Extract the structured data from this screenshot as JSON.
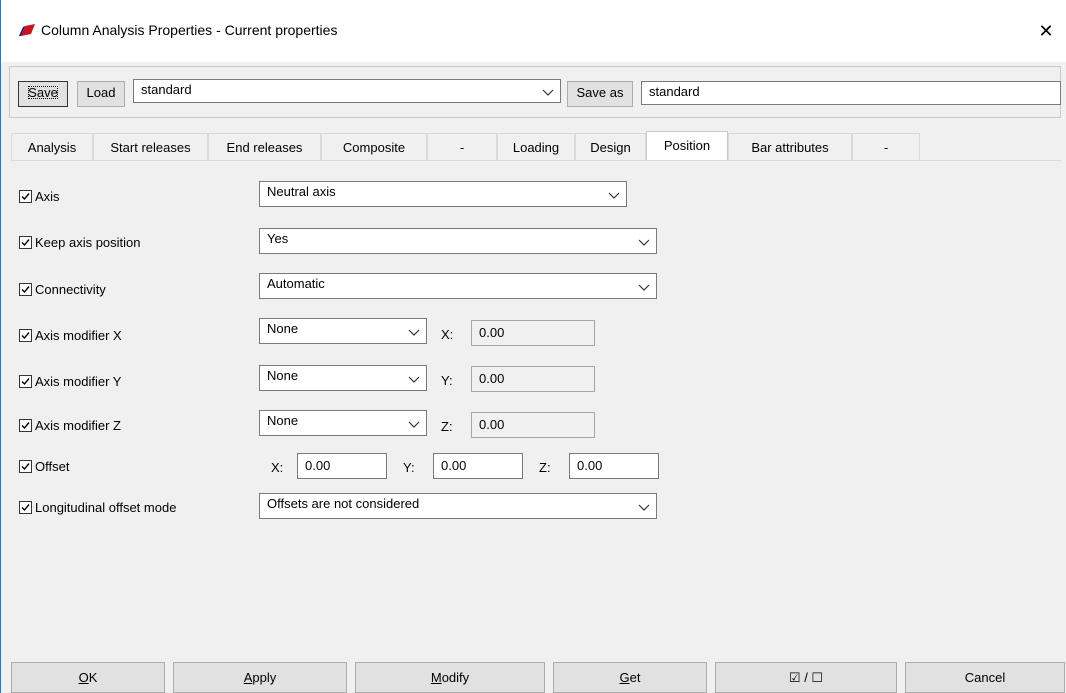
{
  "window": {
    "title": "Column Analysis Properties - Current properties",
    "close_glyph": "✕",
    "accent_color": "#1f77d0",
    "icon": "app-logo-icon"
  },
  "toolbar": {
    "save_label": "Save",
    "load_label": "Load",
    "preset_value": "standard",
    "save_as_label": "Save as",
    "save_as_value": "standard"
  },
  "tabs": [
    {
      "label": "Analysis"
    },
    {
      "label": "Start releases"
    },
    {
      "label": "End releases"
    },
    {
      "label": "Composite"
    },
    {
      "label": "-"
    },
    {
      "label": "Loading"
    },
    {
      "label": "Design"
    },
    {
      "label": "Position"
    },
    {
      "label": "Bar attributes"
    },
    {
      "label": "-"
    }
  ],
  "active_tab": "Position",
  "rows": {
    "axis": {
      "label": "Axis",
      "checked": true,
      "value": "Neutral axis"
    },
    "keep_axis": {
      "label": "Keep axis position",
      "checked": true,
      "value": "Yes"
    },
    "connectivity": {
      "label": "Connectivity",
      "checked": true,
      "value": "Automatic"
    },
    "mod_x": {
      "label": "Axis modifier X",
      "checked": true,
      "value": "None",
      "coord_label": "X:",
      "coord_value": "0.00"
    },
    "mod_y": {
      "label": "Axis modifier Y",
      "checked": true,
      "value": "None",
      "coord_label": "Y:",
      "coord_value": "0.00"
    },
    "mod_z": {
      "label": "Axis modifier Z",
      "checked": true,
      "value": "None",
      "coord_label": "Z:",
      "coord_value": "0.00"
    },
    "offset": {
      "label": "Offset",
      "checked": true,
      "x_label": "X:",
      "x_value": "0.00",
      "y_label": "Y:",
      "y_value": "0.00",
      "z_label": "Z:",
      "z_value": "0.00"
    },
    "long_offset": {
      "label": "Longitudinal offset mode",
      "checked": true,
      "value": "Offsets are not considered"
    }
  },
  "buttons": {
    "ok": {
      "accel": "O",
      "rest": "K"
    },
    "apply": {
      "accel": "A",
      "rest": "pply"
    },
    "modify": {
      "accel": "M",
      "rest": "odify"
    },
    "get": {
      "accel": "G",
      "rest": "et"
    },
    "toggle": "☑ / ☐",
    "cancel": "Cancel"
  }
}
